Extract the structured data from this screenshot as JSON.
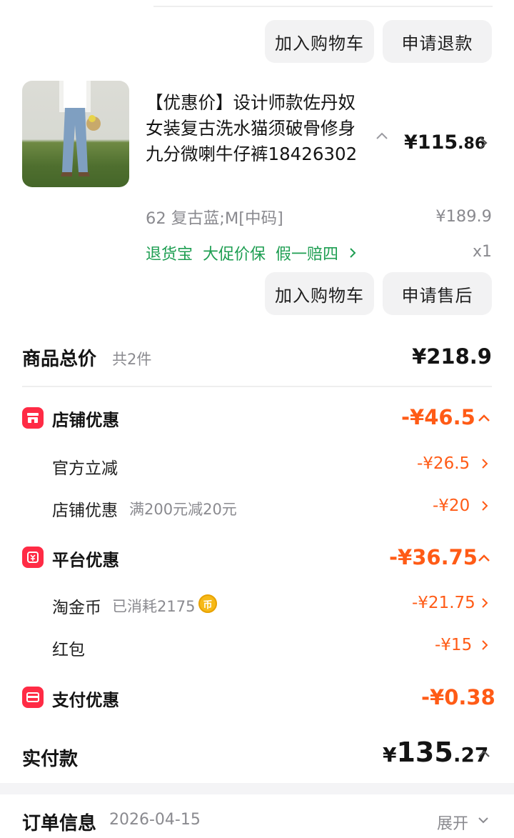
{
  "top_item": {
    "add_to_cart_label": "加入购物车",
    "refund_label": "申请退款"
  },
  "item": {
    "title": "【优惠价】设计师款佐丹奴女装复古洗水猫须破骨修身九分微喇牛仔裤18426302",
    "price_currency": "¥",
    "price_int": "115",
    "price_dec": ".86",
    "spec": "62 复古蓝;M[中码]",
    "original_price": "¥189.9",
    "tags": [
      "退货宝",
      "大促价保",
      "假一赔四"
    ],
    "quantity": "x1",
    "add_to_cart_label": "加入购物车",
    "after_sales_label": "申请售后"
  },
  "summary": {
    "total_label": "商品总价",
    "total_count": "共2件",
    "total_value": "¥218.9",
    "store_discount": {
      "label": "店铺优惠",
      "value": "-¥46.5",
      "items": [
        {
          "label": "官方立减",
          "note": "",
          "value": "-¥26.5"
        },
        {
          "label": "店铺优惠",
          "note": "满200元减20元",
          "value": "-¥20"
        }
      ]
    },
    "platform_discount": {
      "label": "平台优惠",
      "value": "-¥36.75",
      "items": [
        {
          "label": "淘金币",
          "note": "已消耗2175",
          "value": "-¥21.75"
        },
        {
          "label": "红包",
          "note": "",
          "value": "-¥15"
        }
      ]
    },
    "payment_discount": {
      "label": "支付优惠",
      "value": "-¥0.38"
    },
    "paid_label": "实付款",
    "paid_currency": "¥",
    "paid_int": "135",
    "paid_dec": ".27"
  },
  "order_info": {
    "label": "订单信息",
    "date": "2026-04-15",
    "expand_label": "展开"
  },
  "colors": {
    "discount_orange": "#ff5b16",
    "tag_green": "#1e9e52",
    "icon_red": "#ff2b45",
    "coin_gold": "#f6b918"
  }
}
